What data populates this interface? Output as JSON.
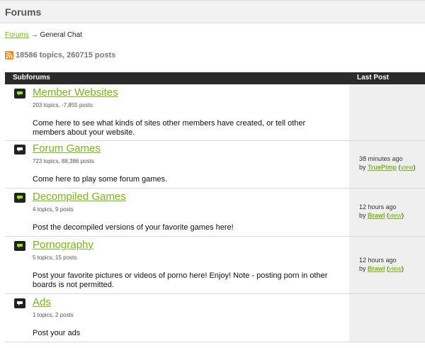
{
  "header": {
    "title": "Forums"
  },
  "breadcrumb": {
    "root": "Forums",
    "separator": " → ",
    "current": "General Chat"
  },
  "stats": {
    "text": "18586 topics, 260715 posts",
    "icon": "rss-icon"
  },
  "table": {
    "col_subforums": "Subforums",
    "col_last_post": "Last Post"
  },
  "colors": {
    "accent": "#7bb31a",
    "header_bg": "#2b2b2b",
    "icon_green": "#9adf1f"
  },
  "forums": [
    {
      "title": "Member Websites",
      "meta": "203 topics, -7,855 posts",
      "desc": "Come here to see what kinds of sites other members have created, or tell other members about your website.",
      "new": true,
      "last_time": "",
      "last_by_prefix": "",
      "last_user": "",
      "last_view": ""
    },
    {
      "title": "Forum Games",
      "meta": "723 topics, 88,386 posts",
      "desc": "Come here to play some forum games.",
      "new": false,
      "last_time": "38 minutes ago",
      "last_by_prefix": "by ",
      "last_user": "TruePimp",
      "last_view": "view"
    },
    {
      "title": "Decompiled Games",
      "meta": "4 topics, 9 posts",
      "desc": "Post the decompiled versions of your favorite games here!",
      "new": true,
      "last_time": "12 hours ago",
      "last_by_prefix": "by ",
      "last_user": "Brawl",
      "last_view": "view"
    },
    {
      "title": "Pornography",
      "meta": "5 topics, 15 posts",
      "desc": "Post your favorite pictures or videos of porno here! Enjoy! Note - posting porn in other boards is not permitted.",
      "new": true,
      "last_time": "12 hours ago",
      "last_by_prefix": "by ",
      "last_user": "Brawl",
      "last_view": "view"
    },
    {
      "title": "Ads",
      "meta": "1 topics, 2 posts",
      "desc": "Post your ads",
      "new": false,
      "last_time": "",
      "last_by_prefix": "",
      "last_user": "",
      "last_view": ""
    }
  ]
}
